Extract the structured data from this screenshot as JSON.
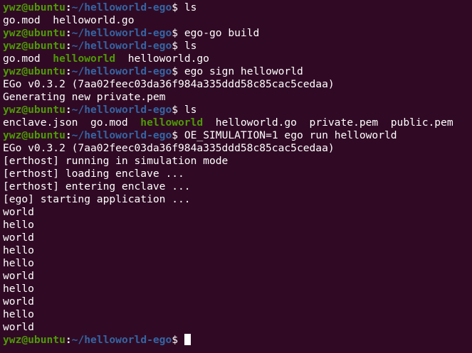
{
  "terminal": {
    "user_host": "ywz@ubuntu",
    "path": "~/helloworld-ego",
    "prompt_symbol": "$",
    "lines": [
      {
        "type": "prompt",
        "cmd": " ls"
      },
      {
        "type": "output",
        "text": "go.mod  helloworld.go"
      },
      {
        "type": "prompt",
        "cmd": " ego-go build"
      },
      {
        "type": "prompt",
        "cmd": " ls"
      },
      {
        "type": "listing",
        "parts": [
          {
            "text": "go.mod  ",
            "exec": false
          },
          {
            "text": "helloworld",
            "exec": true
          },
          {
            "text": "  helloworld.go",
            "exec": false
          }
        ]
      },
      {
        "type": "prompt",
        "cmd": " ego sign helloworld"
      },
      {
        "type": "output",
        "text": "EGo v0.3.2 (7aa02feec03da36f984a335ddd58c85cac5cedaa)"
      },
      {
        "type": "output",
        "text": "Generating new private.pem"
      },
      {
        "type": "prompt",
        "cmd": " ls"
      },
      {
        "type": "listing",
        "parts": [
          {
            "text": "enclave.json  go.mod  ",
            "exec": false
          },
          {
            "text": "helloworld",
            "exec": true
          },
          {
            "text": "  helloworld.go  private.pem  public.pem",
            "exec": false
          }
        ]
      },
      {
        "type": "prompt",
        "cmd": " OE_SIMULATION=1 ego run helloworld"
      },
      {
        "type": "output",
        "text": "EGo v0.3.2 (7aa02feec03da36f984a335ddd58c85cac5cedaa)"
      },
      {
        "type": "output",
        "text": "[erthost] running in simulation mode"
      },
      {
        "type": "output",
        "text": "[erthost] loading enclave ..."
      },
      {
        "type": "output",
        "text": "[erthost] entering enclave ..."
      },
      {
        "type": "output",
        "text": "[ego] starting application ..."
      },
      {
        "type": "output",
        "text": "world"
      },
      {
        "type": "output",
        "text": "hello"
      },
      {
        "type": "output",
        "text": "world"
      },
      {
        "type": "output",
        "text": "hello"
      },
      {
        "type": "output",
        "text": "hello"
      },
      {
        "type": "output",
        "text": "world"
      },
      {
        "type": "output",
        "text": "hello"
      },
      {
        "type": "output",
        "text": "world"
      },
      {
        "type": "output",
        "text": "hello"
      },
      {
        "type": "output",
        "text": "world"
      },
      {
        "type": "prompt",
        "cmd": " ",
        "cursor": true
      }
    ]
  },
  "colors": {
    "background": "#300a24",
    "user_host": "#4e9a06",
    "path": "#3465a4",
    "text": "#ffffff",
    "executable": "#4e9a06"
  }
}
